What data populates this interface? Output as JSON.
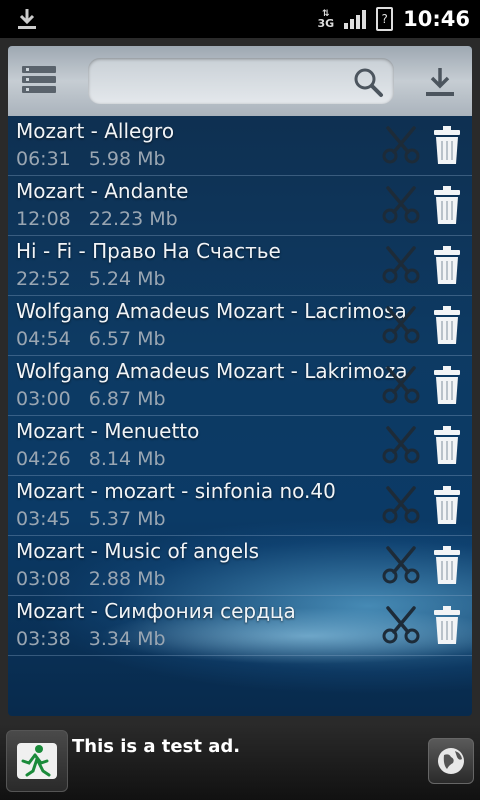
{
  "status_bar": {
    "network_type": "3G",
    "battery": "?",
    "time": "10:46"
  },
  "toolbar": {
    "search": {
      "value": "",
      "placeholder": ""
    }
  },
  "tracks": [
    {
      "title": "Mozart - Allegro",
      "duration": "06:31",
      "size": "5.98 Mb"
    },
    {
      "title": "Mozart - Andante",
      "duration": "12:08",
      "size": "22.23 Mb"
    },
    {
      "title": "Hi - Fi - Право На Счастье",
      "duration": "22:52",
      "size": "5.24 Mb"
    },
    {
      "title": "Wolfgang Amadeus Mozart - Lacrimosa",
      "duration": "04:54",
      "size": "6.57 Mb"
    },
    {
      "title": "Wolfgang Amadeus Mozart - Lakrimoza",
      "duration": "03:00",
      "size": "6.87 Mb"
    },
    {
      "title": "Mozart - Menuetto",
      "duration": "04:26",
      "size": "8.14 Mb"
    },
    {
      "title": "Mozart - mozart - sinfonia no.40",
      "duration": "03:45",
      "size": "5.37 Mb"
    },
    {
      "title": "Mozart - Music of angels",
      "duration": "03:08",
      "size": "2.88 Mb"
    },
    {
      "title": "Mozart - Симфония сердца",
      "duration": "03:38",
      "size": "3.34 Mb"
    }
  ],
  "ad": {
    "text": "This is a test ad."
  },
  "icons": {
    "status_download": "download-icon",
    "menu": "list-menu-icon",
    "search": "search-icon",
    "download": "download-icon",
    "cut": "scissors-icon",
    "delete": "trash-icon",
    "ad_logo": "running-man-icon",
    "ad_globe": "globe-icon"
  },
  "colors": {
    "toolbar": "#c6cdd3",
    "list_background": "#0d3a63",
    "title_text": "#f1f4f7",
    "meta_text": "#9aa6b2"
  }
}
